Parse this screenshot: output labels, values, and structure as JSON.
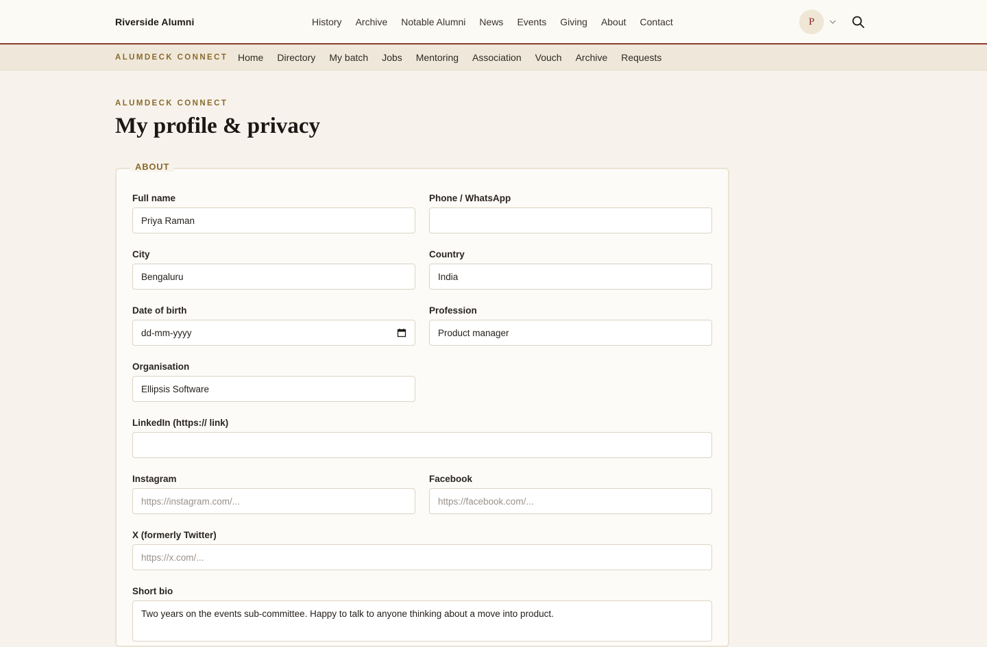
{
  "header": {
    "brand": "Riverside Alumni",
    "nav": [
      "History",
      "Archive",
      "Notable Alumni",
      "News",
      "Events",
      "Giving",
      "About",
      "Contact"
    ],
    "avatar_initial": "P"
  },
  "subnav": {
    "brand": "ALUMDECK CONNECT",
    "items": [
      "Home",
      "Directory",
      "My batch",
      "Jobs",
      "Mentoring",
      "Association",
      "Vouch",
      "Archive",
      "Requests"
    ]
  },
  "page": {
    "eyebrow": "ALUMDECK CONNECT",
    "title": "My profile & privacy"
  },
  "about": {
    "legend": "ABOUT",
    "full_name": {
      "label": "Full name",
      "value": "Priya Raman"
    },
    "phone": {
      "label": "Phone / WhatsApp",
      "value": ""
    },
    "city": {
      "label": "City",
      "value": "Bengaluru"
    },
    "country": {
      "label": "Country",
      "value": "India"
    },
    "dob": {
      "label": "Date of birth",
      "value": "dd-mm-yyyy"
    },
    "profession": {
      "label": "Profession",
      "value": "Product manager"
    },
    "organisation": {
      "label": "Organisation",
      "value": "Ellipsis Software"
    },
    "linkedin": {
      "label": "LinkedIn (https:// link)",
      "value": ""
    },
    "instagram": {
      "label": "Instagram",
      "placeholder": "https://instagram.com/..."
    },
    "facebook": {
      "label": "Facebook",
      "placeholder": "https://facebook.com/..."
    },
    "x": {
      "label": "X (formerly Twitter)",
      "placeholder": "https://x.com/..."
    },
    "bio": {
      "label": "Short bio",
      "value": "Two years on the events sub-committee. Happy to talk to anyone thinking about a move into product."
    }
  },
  "colors": {
    "accent": "#8a3a2e",
    "gold": "#8a6a2c",
    "background": "#f7f3ec"
  }
}
